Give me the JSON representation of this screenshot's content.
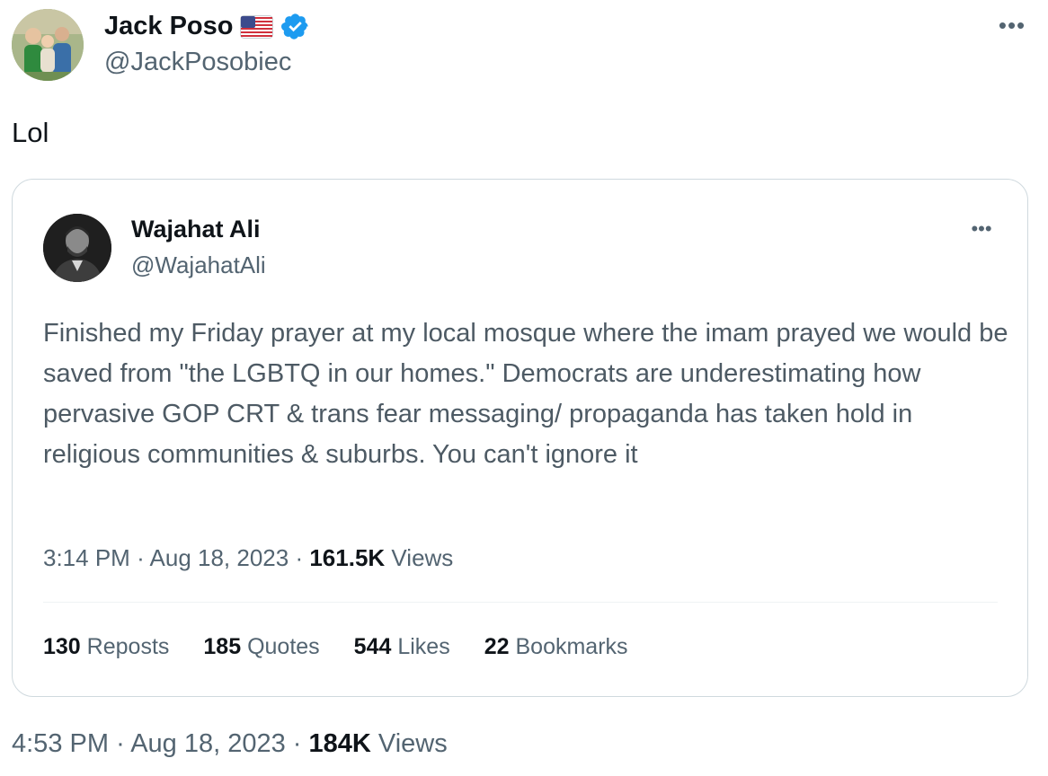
{
  "tweet": {
    "author_name": "Jack Poso",
    "author_handle": "@JackPosobiec",
    "text": "Lol",
    "time": "4:53 PM",
    "date": "Aug 18, 2023",
    "views_count": "184K",
    "views_label": "Views",
    "icons": {
      "flag": "us-flag-icon",
      "verified": "verified-badge-icon",
      "more": "more-icon"
    },
    "colors": {
      "verified": "#1d9bf0",
      "secondary_text": "#536471",
      "primary_text": "#0f1419"
    }
  },
  "quote": {
    "author_name": "Wajahat Ali",
    "author_handle": "@WajahatAli",
    "text": "Finished my Friday prayer at my local mosque where the imam prayed we would be saved from \"the LGBTQ in our homes.\" Democrats are underestimating how pervasive GOP CRT & trans fear messaging/ propaganda has taken hold in religious communities & suburbs. You can't ignore it",
    "time": "3:14 PM",
    "date": "Aug 18, 2023",
    "views_count": "161.5K",
    "views_label": "Views",
    "stats": [
      {
        "count": "130",
        "label": "Reposts"
      },
      {
        "count": "185",
        "label": "Quotes"
      },
      {
        "count": "544",
        "label": "Likes"
      },
      {
        "count": "22",
        "label": "Bookmarks"
      }
    ]
  }
}
